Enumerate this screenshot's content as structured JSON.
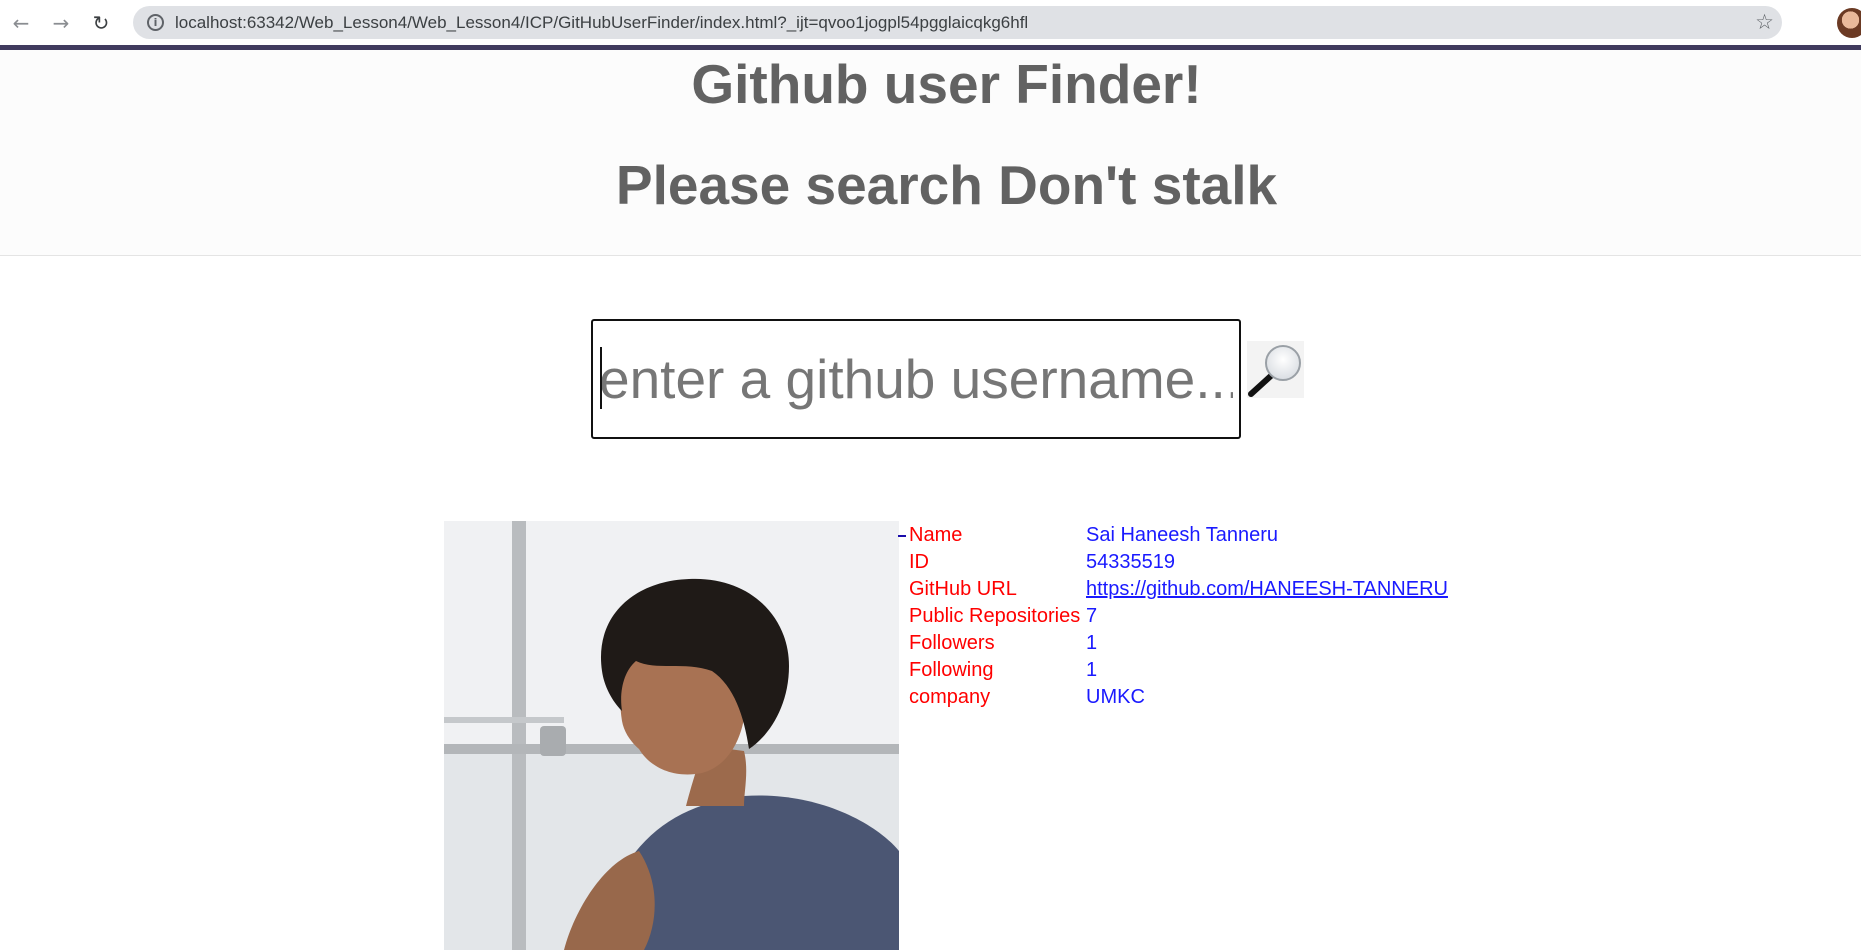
{
  "browser": {
    "url": "localhost:63342/Web_Lesson4/Web_Lesson4/ICP/GitHubUserFinder/index.html?_ijt=qvoo1jogpl54pgglaicqkg6hfl",
    "back_icon": "back-arrow-icon",
    "forward_icon": "forward-arrow-icon",
    "reload_icon": "reload-icon",
    "bookmark_icon": "star-icon"
  },
  "header": {
    "title": "Github user Finder!",
    "subtitle": "Please search Don't stalk"
  },
  "search": {
    "placeholder": "enter a github username...",
    "value": "",
    "button_icon": "magnifying-glass-icon"
  },
  "user": {
    "fields": [
      {
        "label": "Name",
        "value": "Sai Haneesh Tanneru"
      },
      {
        "label": "ID",
        "value": "54335519"
      },
      {
        "label": "GitHub URL",
        "value": "https://github.com/HANEESH-TANNERU"
      },
      {
        "label": "Public Repositories",
        "value": "7"
      },
      {
        "label": "Followers",
        "value": "1"
      },
      {
        "label": "Following",
        "value": "1"
      },
      {
        "label": "company",
        "value": "UMKC"
      }
    ]
  },
  "colors": {
    "label_color": "#ff0000",
    "value_color": "#1a1aff",
    "title_color": "#626262"
  }
}
